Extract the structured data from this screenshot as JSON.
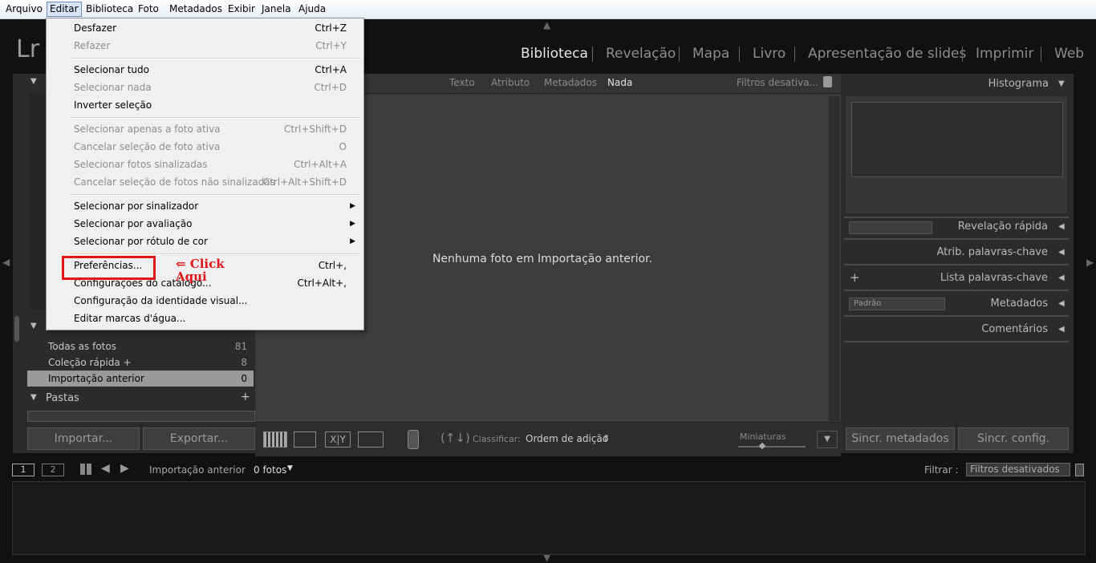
{
  "menubar": {
    "items": [
      "Arquivo",
      "Editar",
      "Biblioteca",
      "Foto",
      "Metadados",
      "Exibir",
      "Janela",
      "Ajuda"
    ]
  },
  "app": {
    "logo": "Lr"
  },
  "modules": [
    "Biblioteca",
    "Revelação",
    "Mapa",
    "Livro",
    "Apresentação de slides",
    "Imprimir",
    "Web"
  ],
  "edit_menu": {
    "items": [
      {
        "label": "Desfazer",
        "shortcut": "Ctrl+Z"
      },
      {
        "label": "Refazer",
        "shortcut": "Ctrl+Y"
      },
      {
        "label": "Selecionar tudo",
        "shortcut": "Ctrl+A"
      },
      {
        "label": "Selecionar nada",
        "shortcut": "Ctrl+D"
      },
      {
        "label": "Inverter seleção",
        "shortcut": ""
      },
      {
        "label": "Selecionar apenas a foto ativa",
        "shortcut": "Ctrl+Shift+D"
      },
      {
        "label": "Cancelar seleção de foto ativa",
        "shortcut": "O"
      },
      {
        "label": "Selecionar fotos sinalizadas",
        "shortcut": "Ctrl+Alt+A"
      },
      {
        "label": "Cancelar seleção de fotos não sinalizadas",
        "shortcut": "Ctrl+Alt+Shift+D"
      },
      {
        "label": "Selecionar por sinalizador",
        "shortcut": ""
      },
      {
        "label": "Selecionar por avaliação",
        "shortcut": ""
      },
      {
        "label": "Selecionar por rótulo de cor",
        "shortcut": ""
      },
      {
        "label": "Preferências...",
        "shortcut": "Ctrl+,"
      },
      {
        "label": "Configurações do catálogo...",
        "shortcut": "Ctrl+Alt+,"
      },
      {
        "label": "Configuração da identidade visual...",
        "shortcut": ""
      },
      {
        "label": "Editar marcas d'água...",
        "shortcut": ""
      }
    ]
  },
  "annotation": {
    "line1": "⇐ Click",
    "line2": "Aqui"
  },
  "filter_bar": {
    "text": "Texto",
    "attribute": "Atributo",
    "metadata": "Metadados",
    "none": "Nada",
    "filters": "Filtros desativa..."
  },
  "grid": {
    "empty_message": "Nenhuma foto em Importação anterior."
  },
  "left_panel": {
    "collections": [
      {
        "label": "Todas as fotos",
        "count": "81"
      },
      {
        "label": "Coleção rápida +",
        "count": "8"
      },
      {
        "label": "Importação anterior",
        "count": "0"
      }
    ],
    "folders_header": "Pastas",
    "import_button": "Importar...",
    "export_button": "Exportar..."
  },
  "toolbar": {
    "sort_label": "Classificar:",
    "sort_value": "Ordem de adição",
    "thumbnails_label": "Miniaturas"
  },
  "right_panel": {
    "histogram": "Histograma",
    "quick_develop": "Revelação rápida",
    "keywording": "Atrib. palavras-chave",
    "keyword_list": "Lista palavras-chave",
    "metadata": "Metadados",
    "metadata_preset": "Padrão",
    "comments": "Comentários",
    "sync_metadata_button": "Sincr. metadados",
    "sync_settings_button": "Sincr. config."
  },
  "filmstrip": {
    "view1": "1",
    "view2": "2",
    "source": "Importação anterior",
    "count": "0 fotos",
    "filter_label": "Filtrar :",
    "filter_value": "Filtros desativados"
  }
}
